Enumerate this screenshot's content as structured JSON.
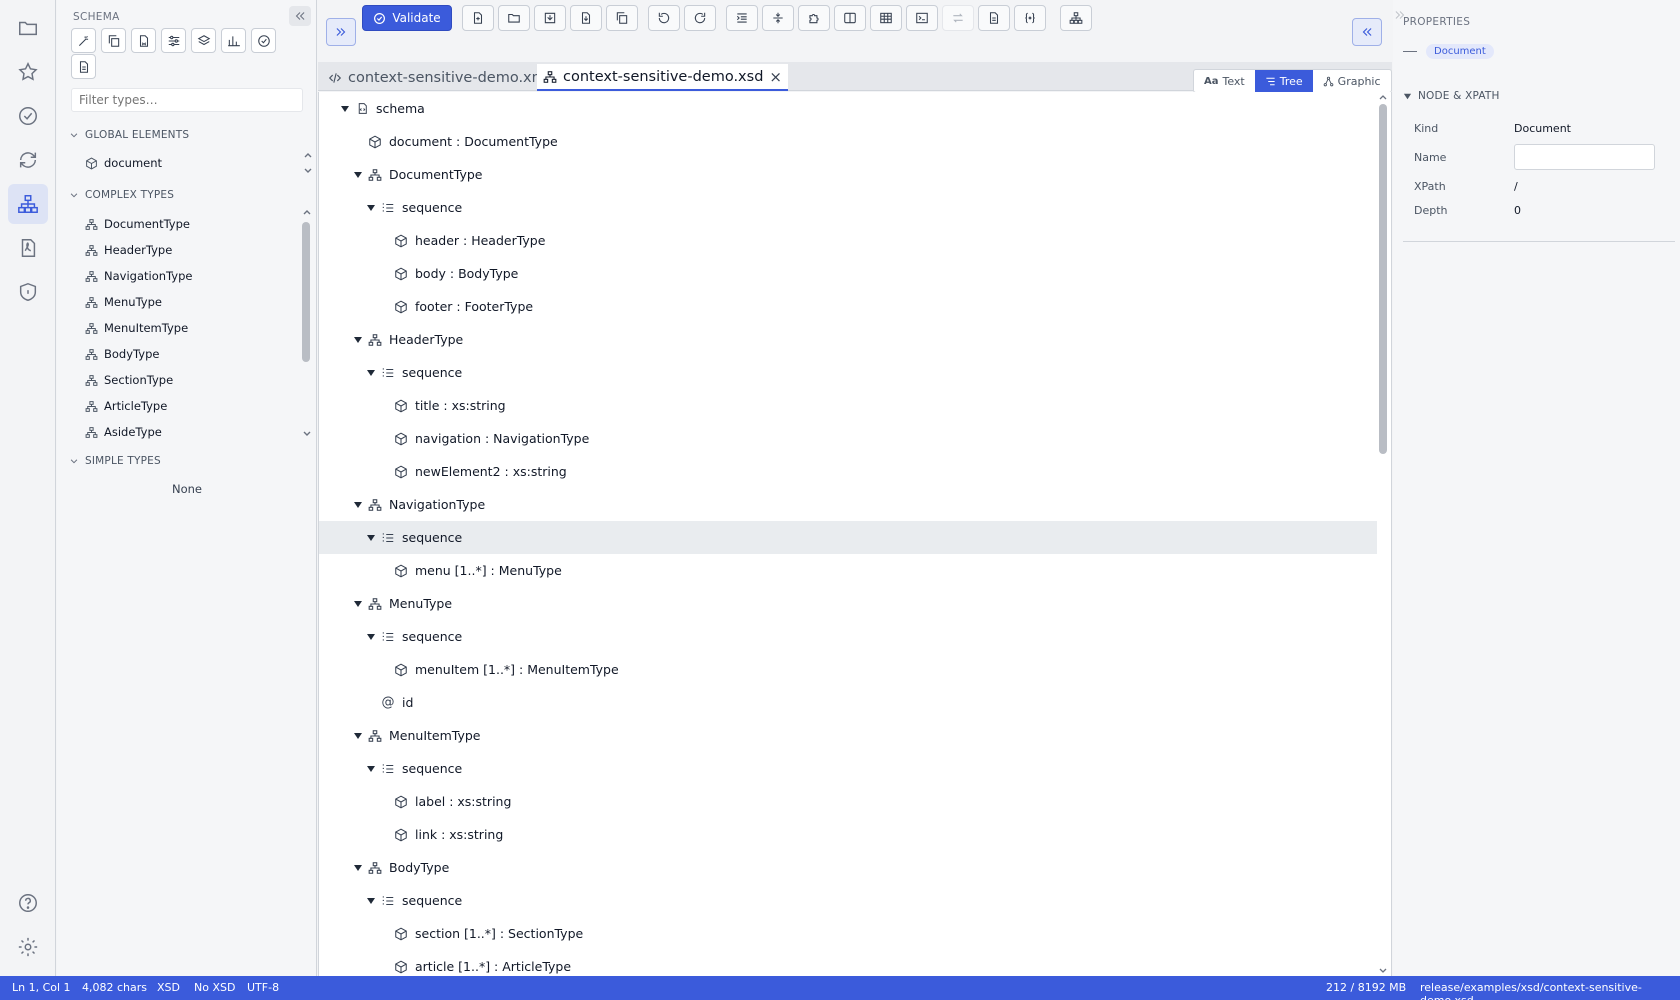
{
  "activity": {
    "items": [
      "folder-icon",
      "star-icon",
      "check-circle-icon",
      "sync-icon",
      "schema-tree-icon",
      "pdf-icon",
      "shield-icon"
    ],
    "bottom": [
      "help-icon",
      "gear-icon"
    ]
  },
  "sidebar": {
    "title": "SCHEMA",
    "filter_placeholder": "Filter types…",
    "global_elements_label": "GLOBAL ELEMENTS",
    "global_elements": [
      "document"
    ],
    "complex_types_label": "COMPLEX TYPES",
    "complex_types": [
      "DocumentType",
      "HeaderType",
      "NavigationType",
      "MenuType",
      "MenuItemType",
      "BodyType",
      "SectionType",
      "ArticleType",
      "AsideType"
    ],
    "simple_types_label": "SIMPLE TYPES",
    "simple_types_empty": "None"
  },
  "toolbar": {
    "validate_label": "Validate"
  },
  "tabs": {
    "xml_tab": "context-sensitive-demo.xml",
    "xsd_tab": "context-sensitive-demo.xsd",
    "close_glyph": "×"
  },
  "view_modes": {
    "text": "Text",
    "tree": "Tree",
    "graphic": "Graphic",
    "text_prefix": "Aa"
  },
  "tree": {
    "rows": [
      {
        "depth": 0,
        "caret": true,
        "icon": "schema",
        "label": "schema"
      },
      {
        "depth": 1,
        "caret": false,
        "icon": "element",
        "label": "document : DocumentType"
      },
      {
        "depth": 1,
        "caret": true,
        "icon": "complex",
        "label": "DocumentType"
      },
      {
        "depth": 2,
        "caret": true,
        "icon": "sequence",
        "label": "sequence"
      },
      {
        "depth": 3,
        "caret": false,
        "icon": "element",
        "label": "header : HeaderType"
      },
      {
        "depth": 3,
        "caret": false,
        "icon": "element",
        "label": "body : BodyType"
      },
      {
        "depth": 3,
        "caret": false,
        "icon": "element",
        "label": "footer : FooterType"
      },
      {
        "depth": 1,
        "caret": true,
        "icon": "complex",
        "label": "HeaderType"
      },
      {
        "depth": 2,
        "caret": true,
        "icon": "sequence",
        "label": "sequence"
      },
      {
        "depth": 3,
        "caret": false,
        "icon": "element",
        "label": "title : xs:string"
      },
      {
        "depth": 3,
        "caret": false,
        "icon": "element",
        "label": "navigation : NavigationType"
      },
      {
        "depth": 3,
        "caret": false,
        "icon": "element",
        "label": "newElement2 : xs:string"
      },
      {
        "depth": 1,
        "caret": true,
        "icon": "complex",
        "label": "NavigationType"
      },
      {
        "depth": 2,
        "caret": true,
        "icon": "sequence",
        "label": "sequence",
        "selected": true
      },
      {
        "depth": 3,
        "caret": false,
        "icon": "element",
        "label": "menu [1..*] : MenuType"
      },
      {
        "depth": 1,
        "caret": true,
        "icon": "complex",
        "label": "MenuType"
      },
      {
        "depth": 2,
        "caret": true,
        "icon": "sequence",
        "label": "sequence"
      },
      {
        "depth": 3,
        "caret": false,
        "icon": "element",
        "label": "menuItem [1..*] : MenuItemType"
      },
      {
        "depth": 2,
        "caret": false,
        "icon": "attribute",
        "label": "id"
      },
      {
        "depth": 1,
        "caret": true,
        "icon": "complex",
        "label": "MenuItemType"
      },
      {
        "depth": 2,
        "caret": true,
        "icon": "sequence",
        "label": "sequence"
      },
      {
        "depth": 3,
        "caret": false,
        "icon": "element",
        "label": "label : xs:string"
      },
      {
        "depth": 3,
        "caret": false,
        "icon": "element",
        "label": "link : xs:string"
      },
      {
        "depth": 1,
        "caret": true,
        "icon": "complex",
        "label": "BodyType"
      },
      {
        "depth": 2,
        "caret": true,
        "icon": "sequence",
        "label": "sequence"
      },
      {
        "depth": 3,
        "caret": false,
        "icon": "element",
        "label": "section [1..*] : SectionType"
      },
      {
        "depth": 3,
        "caret": false,
        "icon": "element",
        "label": "article [1..*] : ArticleType"
      }
    ]
  },
  "properties": {
    "title": "PROPERTIES",
    "badge": "Document",
    "section_label": "NODE & XPATH",
    "kind_label": "Kind",
    "kind_value": "Document",
    "name_label": "Name",
    "name_value": "",
    "xpath_label": "XPath",
    "xpath_value": "/",
    "depth_label": "Depth",
    "depth_value": "0"
  },
  "status": {
    "position": "Ln 1, Col 1",
    "chars": "4,082 chars",
    "lang": "XSD",
    "schema": "No XSD",
    "encoding": "UTF-8",
    "memory": "212 / 8192 MB",
    "path": "release/examples/xsd/context-sensitive-demo.xsd"
  },
  "colors": {
    "accent": "#3b5bdb",
    "selected_row": "#e9ecef"
  }
}
